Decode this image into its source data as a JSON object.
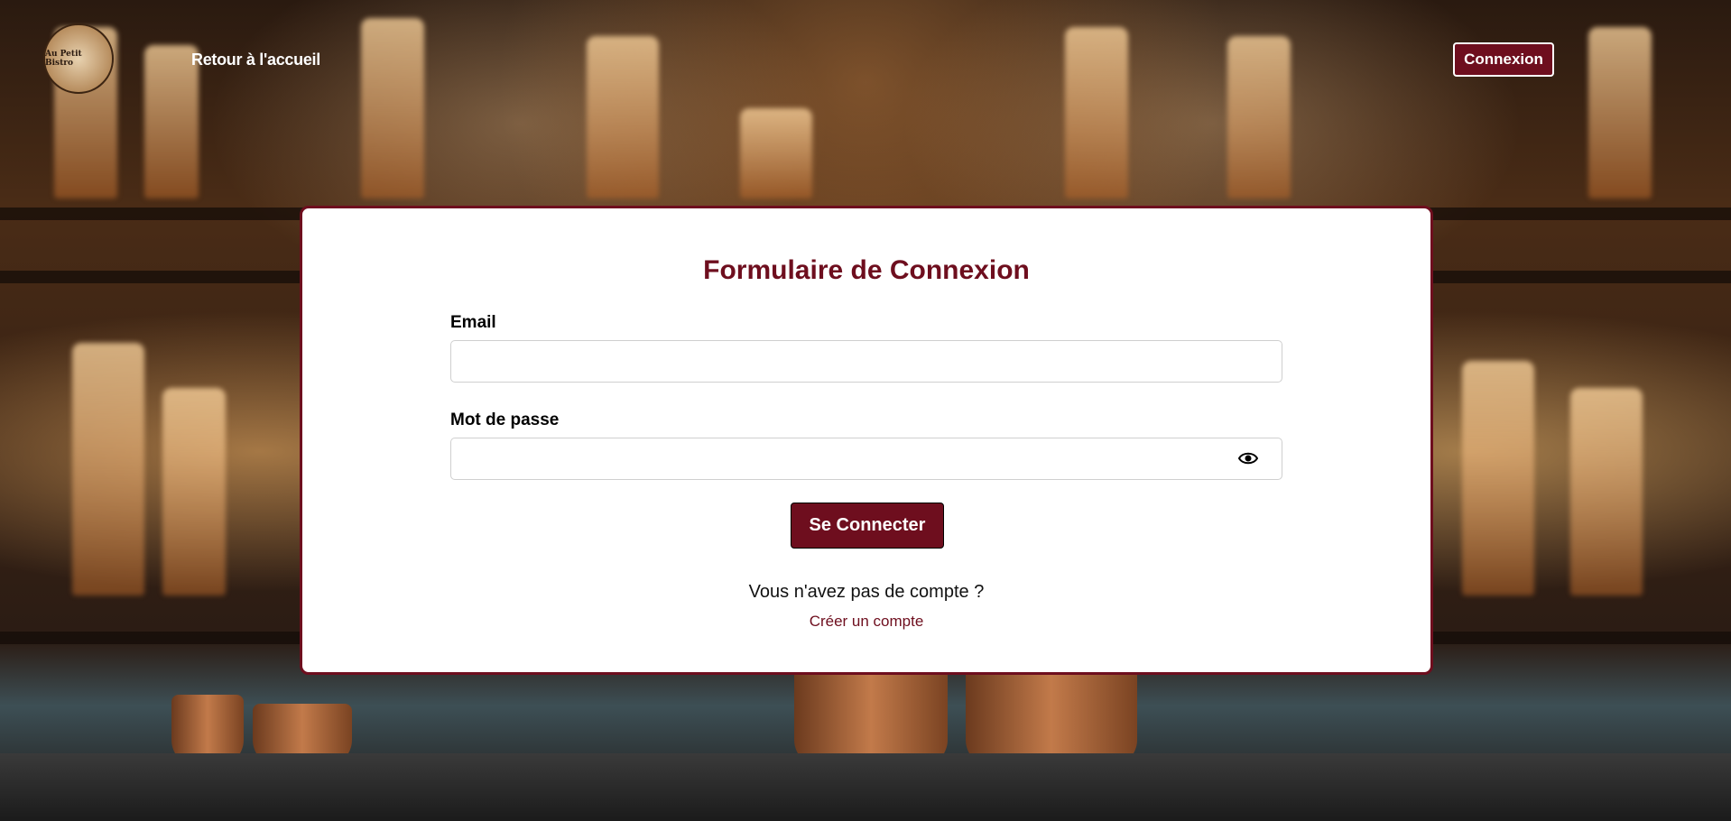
{
  "nav": {
    "logo_text": "Au Petit Bistro",
    "home_link": "Retour à l'accueil",
    "login_button": "Connexion"
  },
  "form": {
    "title": "Formulaire de Connexion",
    "email_label": "Email",
    "email_value": "",
    "password_label": "Mot de passe",
    "password_value": "",
    "show_password_icon": "eye-icon",
    "submit_label": "Se Connecter",
    "no_account_text": "Vous n'avez pas de compte ?",
    "create_account_link": "Créer un compte"
  },
  "colors": {
    "accent": "#6e0e1e",
    "card_background": "#ffffff"
  }
}
